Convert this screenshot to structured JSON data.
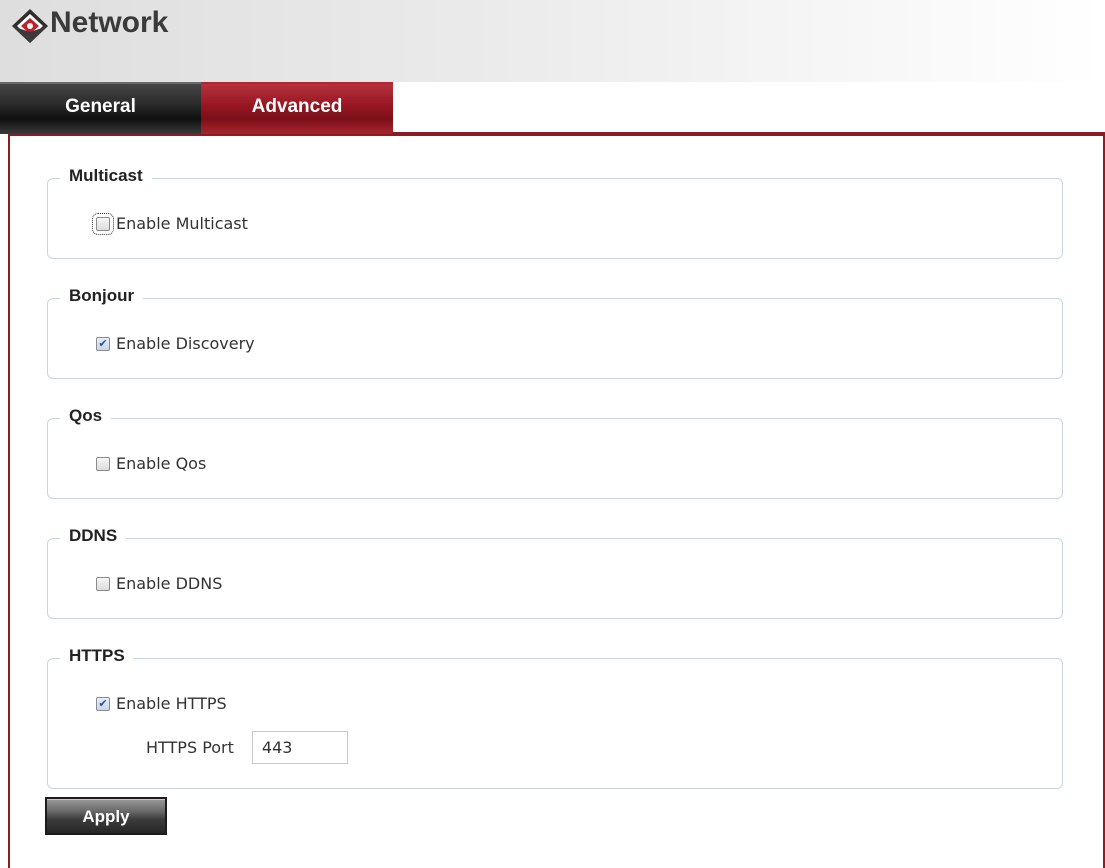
{
  "header": {
    "title": "Network",
    "logo_icon": "diamond-logo-icon"
  },
  "tabs": [
    {
      "label": "General",
      "active": false
    },
    {
      "label": "Advanced",
      "active": true
    }
  ],
  "colors": {
    "accent": "#8a1d22",
    "active_tab": "#9a1824",
    "inactive_tab": "#2b2b2b",
    "group_border": "#c9d5e2",
    "checkbox_check": "#2b4fa8"
  },
  "sections": {
    "multicast": {
      "legend": "Multicast",
      "checkbox_label": "Enable Multicast",
      "checked": false
    },
    "bonjour": {
      "legend": "Bonjour",
      "checkbox_label": "Enable Discovery",
      "checked": true
    },
    "qos": {
      "legend": "Qos",
      "checkbox_label": "Enable Qos",
      "checked": false
    },
    "ddns": {
      "legend": "DDNS",
      "checkbox_label": "Enable DDNS",
      "checked": false
    },
    "https": {
      "legend": "HTTPS",
      "checkbox_label": "Enable HTTPS",
      "checked": true,
      "port_label": "HTTPS Port",
      "port_value": "443"
    }
  },
  "actions": {
    "apply_label": "Apply"
  }
}
